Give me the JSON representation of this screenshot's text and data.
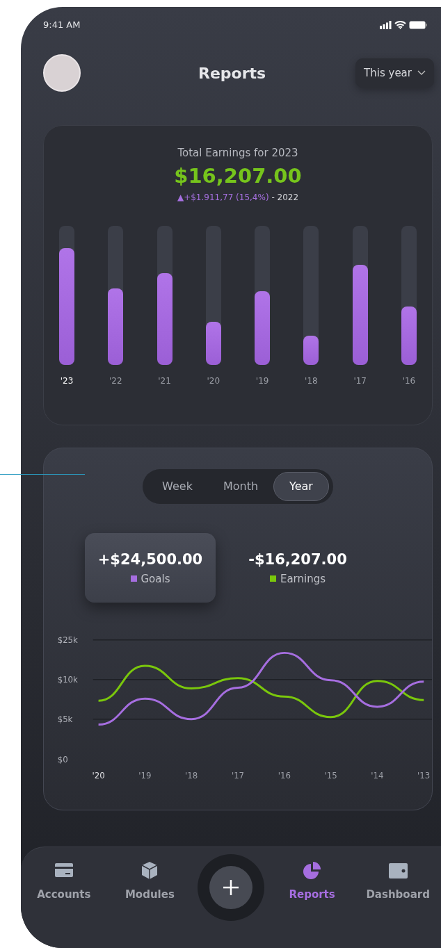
{
  "status_bar": {
    "time": "9:41 AM"
  },
  "header": {
    "title": "Reports",
    "period": "This year"
  },
  "earnings_card": {
    "title": "Total Earnings for 2023",
    "total": "$16,207.00",
    "change": "▲+$1.911,77 (15,4%)",
    "compare": " - 2022",
    "bars": [
      {
        "label": "'23",
        "level": 0.84,
        "selected": true
      },
      {
        "label": "'22",
        "level": 0.55,
        "selected": false
      },
      {
        "label": "'21",
        "level": 0.66,
        "selected": false
      },
      {
        "label": "'20",
        "level": 0.31,
        "selected": false
      },
      {
        "label": "'19",
        "level": 0.53,
        "selected": false
      },
      {
        "label": "'18",
        "level": 0.21,
        "selected": false
      },
      {
        "label": "'17",
        "level": 0.72,
        "selected": false
      },
      {
        "label": "'16",
        "level": 0.42,
        "selected": false
      }
    ]
  },
  "comparison_card": {
    "tabs": [
      {
        "label": "Week",
        "selected": false
      },
      {
        "label": "Month",
        "selected": false
      },
      {
        "label": "Year",
        "selected": true
      }
    ],
    "summary": [
      {
        "amount": "+$24,500.00",
        "label": "Goals",
        "color": "#a66ee0",
        "selected": true
      },
      {
        "amount": "-$16,207.00",
        "label": "Earnings",
        "color": "#7ac70c",
        "selected": false
      }
    ],
    "line_chart": {
      "y_labels": [
        "$25k",
        "$10k",
        "$5k",
        "$0"
      ],
      "x_labels": [
        "'20",
        "'19",
        "'18",
        "'17",
        "'16",
        "'15",
        "'14",
        "'13"
      ]
    }
  },
  "tab_bar": {
    "items": [
      {
        "label": "Accounts",
        "kind": "card",
        "selected": false
      },
      {
        "label": "Modules",
        "kind": "cube",
        "selected": false
      },
      {
        "kind": "add"
      },
      {
        "label": "Reports",
        "kind": "pie",
        "selected": true
      },
      {
        "label": "Dashboard",
        "kind": "wallet",
        "selected": false
      }
    ]
  }
}
